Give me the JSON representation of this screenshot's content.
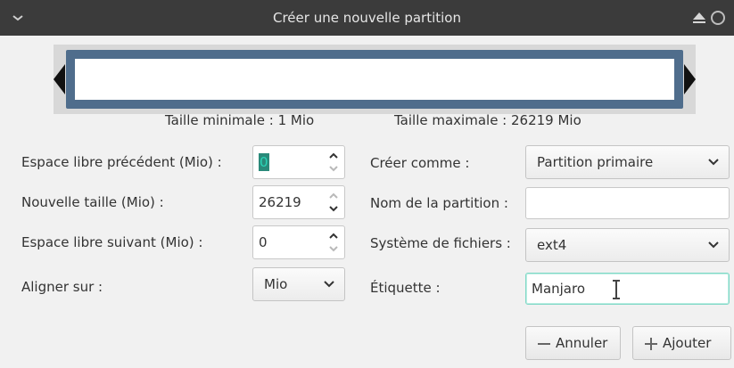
{
  "window": {
    "title": "Créer une nouvelle partition"
  },
  "partition": {
    "min_size_label": "Taille minimale : 1 Mio",
    "max_size_label": "Taille maximale : 26219 Mio"
  },
  "left_form": {
    "free_before": {
      "label": "Espace libre précédent (Mio) :",
      "value": "0"
    },
    "new_size": {
      "label": "Nouvelle taille (Mio) :",
      "value": "26219"
    },
    "free_after": {
      "label": "Espace libre suivant (Mio) :",
      "value": "0"
    },
    "align": {
      "label": "Aligner sur :",
      "value": "Mio"
    }
  },
  "right_form": {
    "create_as": {
      "label": "Créer comme :",
      "value": "Partition primaire"
    },
    "partition_name": {
      "label": "Nom de la partition :",
      "value": ""
    },
    "filesystem": {
      "label": "Système de fichiers :",
      "value": "ext4"
    },
    "label": {
      "label": "Étiquette :",
      "value": "Manjaro"
    }
  },
  "buttons": {
    "cancel": "Annuler",
    "add": "Ajouter"
  },
  "colors": {
    "titlebar": "#3b3b3b",
    "partition_bar": "#4f6d8c",
    "focus_accent": "#2bd6b8"
  }
}
